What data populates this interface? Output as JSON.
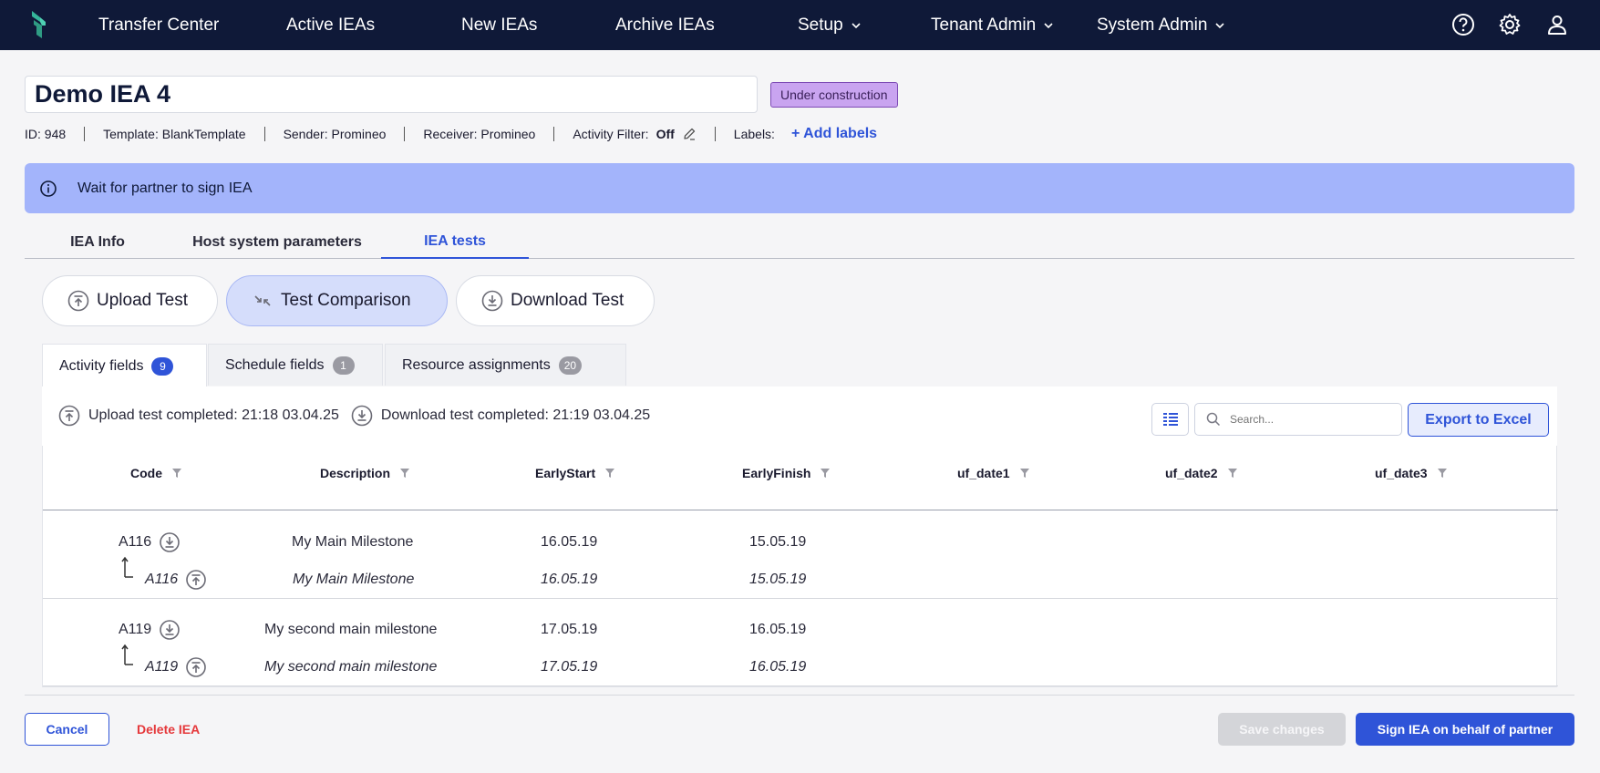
{
  "nav": {
    "items": [
      {
        "label": "Transfer Center"
      },
      {
        "label": "Active IEAs"
      },
      {
        "label": "New IEAs"
      },
      {
        "label": "Archive IEAs"
      },
      {
        "label": "Setup"
      },
      {
        "label": "Tenant Admin"
      },
      {
        "label": "System Admin"
      }
    ],
    "icons": [
      "help-icon",
      "gear-icon",
      "user-icon"
    ]
  },
  "iea": {
    "title": "Demo IEA 4",
    "status": "Under construction",
    "meta": {
      "id": "ID: 948",
      "template": "Template: BlankTemplate",
      "sender": "Sender: Promineo",
      "receiver": "Receiver: Promineo",
      "activity_filter_label": "Activity Filter:",
      "activity_filter_value": "Off",
      "labels_label": "Labels:",
      "add_labels": "+ Add labels"
    }
  },
  "banner": {
    "text": "Wait for partner to sign IEA"
  },
  "main_tabs": [
    {
      "label": "IEA Info"
    },
    {
      "label": "Host system parameters"
    },
    {
      "label": "IEA tests",
      "active": true
    }
  ],
  "actions": {
    "upload": "Upload Test",
    "compare": "Test Comparison",
    "download": "Download Test"
  },
  "sub_tabs": [
    {
      "label": "Activity fields",
      "count": "9"
    },
    {
      "label": "Schedule fields",
      "count": "1"
    },
    {
      "label": "Resource assignments",
      "count": "20"
    }
  ],
  "panel": {
    "upload_status": "Upload test completed: 21:18 03.04.25",
    "download_status": "Download test completed: 21:19 03.04.25",
    "search_placeholder": "Search...",
    "export_label": "Export to Excel"
  },
  "table": {
    "columns": [
      "Code",
      "Description",
      "EarlyStart",
      "EarlyFinish",
      "uf_date1",
      "uf_date2",
      "uf_date3"
    ],
    "rows": [
      {
        "download": {
          "code": "A116",
          "description": "My Main Milestone",
          "early_start": "16.05.19",
          "early_finish": "15.05.19"
        },
        "upload": {
          "code": "A116",
          "description": "My Main Milestone",
          "early_start": "16.05.19",
          "early_finish": "15.05.19"
        }
      },
      {
        "download": {
          "code": "A119",
          "description": "My second main milestone",
          "early_start": "17.05.19",
          "early_finish": "16.05.19"
        },
        "upload": {
          "code": "A119",
          "description": "My second main milestone",
          "early_start": "17.05.19",
          "early_finish": "16.05.19"
        }
      }
    ]
  },
  "footer": {
    "cancel": "Cancel",
    "delete": "Delete IEA",
    "save": "Save changes",
    "sign": "Sign IEA on behalf of partner"
  },
  "colors": {
    "nav_bg": "#0f1938",
    "accent": "#2f54d8",
    "banner_bg": "#a3b4fb",
    "status_badge_bg": "#c9a4f0",
    "danger": "#e5383b"
  }
}
